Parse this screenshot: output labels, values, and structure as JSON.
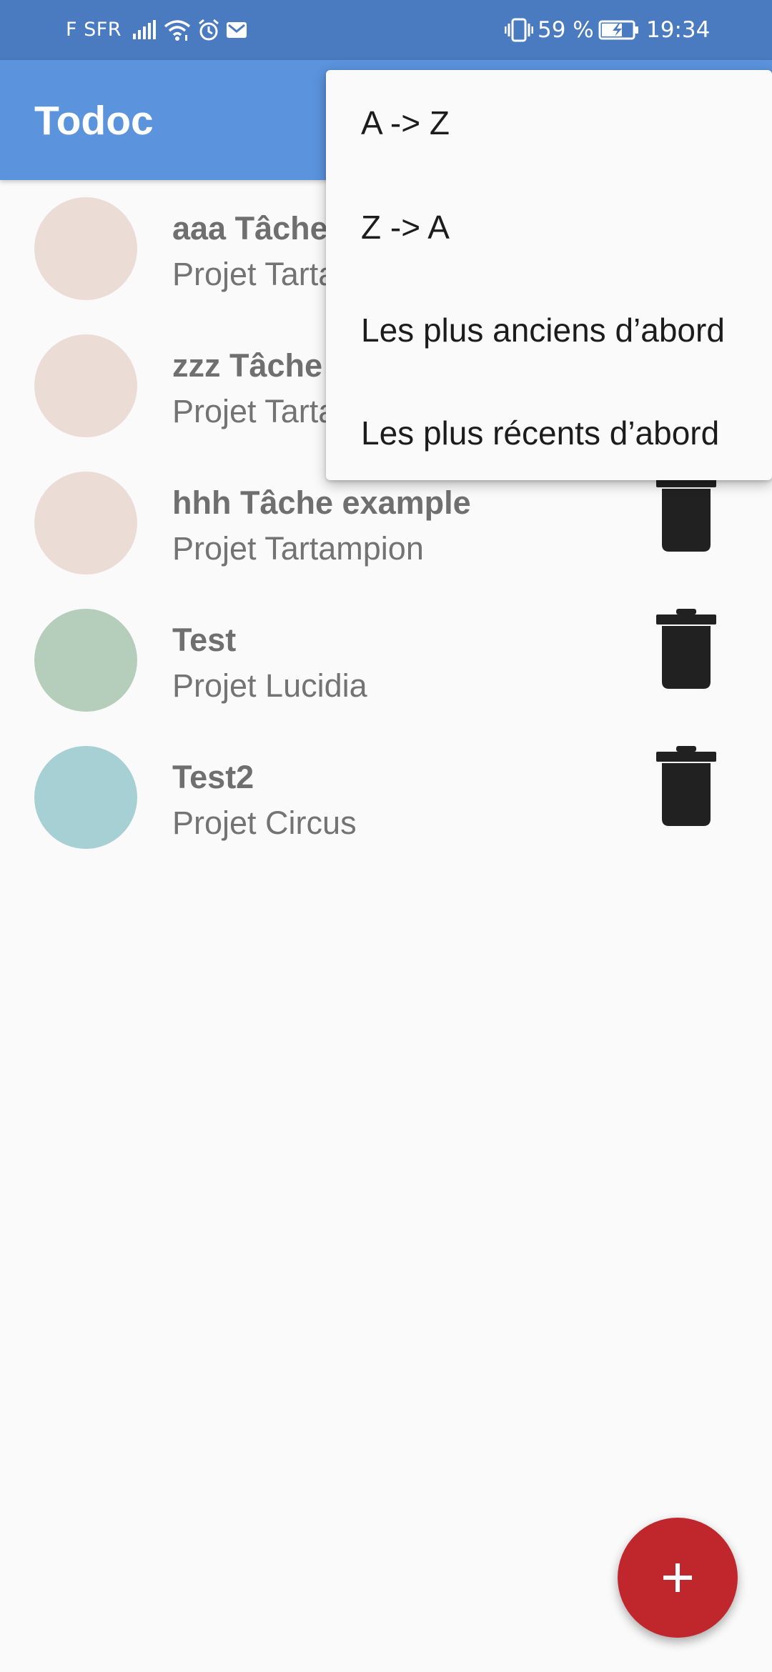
{
  "status_bar": {
    "carrier": "F SFR",
    "battery_percent": "59 %",
    "time": "19:34",
    "icons": [
      "signal-icon",
      "wifi-icon",
      "alarm-icon",
      "mail-icon",
      "vibrate-icon",
      "battery-charging-icon"
    ]
  },
  "toolbar": {
    "title": "Todoc"
  },
  "tasks": [
    {
      "name": "aaa Tâche example",
      "project": "Projet Tartampion",
      "color": "#ebdcd5"
    },
    {
      "name": "zzz Tâche example",
      "project": "Projet Tartampion",
      "color": "#ebdcd5"
    },
    {
      "name": "hhh Tâche example",
      "project": "Projet Tartampion",
      "color": "#ebdcd5"
    },
    {
      "name": "Test",
      "project": "Projet Lucidia",
      "color": "#b5cdbb"
    },
    {
      "name": "Test2",
      "project": "Projet Circus",
      "color": "#a6d0d3"
    }
  ],
  "sort_menu": {
    "items": [
      "A -> Z",
      "Z -> A",
      "Les plus anciens d’abord",
      "Les plus récents d’abord"
    ]
  },
  "fab": {
    "icon": "plus-icon",
    "color": "#c0272d"
  },
  "colors": {
    "status_bar": "#4a7abf",
    "toolbar": "#5b93dc",
    "background": "#fafafa"
  }
}
